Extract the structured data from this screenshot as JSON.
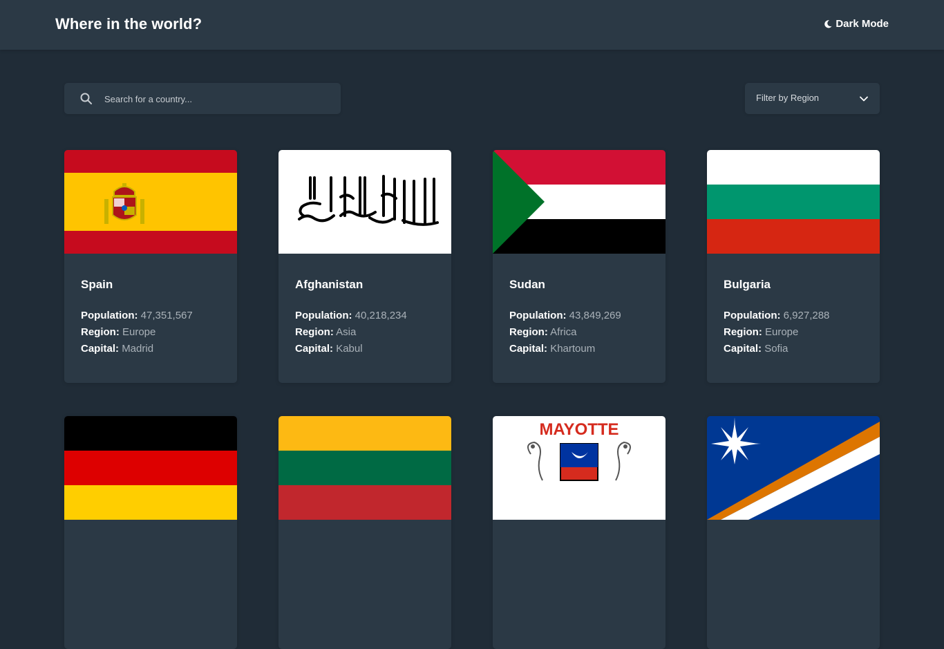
{
  "header": {
    "title": "Where in the world?",
    "mode_label": "Dark Mode"
  },
  "search": {
    "placeholder": "Search for a country..."
  },
  "filter": {
    "label": "Filter by Region"
  },
  "labels": {
    "population": "Population:",
    "region": "Region:",
    "capital": "Capital:"
  },
  "countries": [
    {
      "name": "Spain",
      "population": "47,351,567",
      "region": "Europe",
      "capital": "Madrid"
    },
    {
      "name": "Afghanistan",
      "population": "40,218,234",
      "region": "Asia",
      "capital": "Kabul"
    },
    {
      "name": "Sudan",
      "population": "43,849,269",
      "region": "Africa",
      "capital": "Khartoum"
    },
    {
      "name": "Bulgaria",
      "population": "6,927,288",
      "region": "Europe",
      "capital": "Sofia"
    }
  ],
  "flag_texts": {
    "mayotte": "MAYOTTE"
  },
  "colors": {
    "background": "#202c37",
    "elements": "#2b3945",
    "text": "#ffffff",
    "muted": "#aab2b9"
  }
}
